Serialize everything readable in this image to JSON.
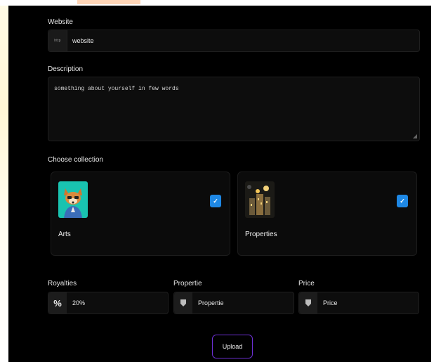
{
  "form": {
    "website": {
      "label": "Website",
      "prefix": "http",
      "value": "website"
    },
    "description": {
      "label": "Description",
      "placeholder": "something about yourself in few words"
    },
    "collection": {
      "label": "Choose collection",
      "cards": [
        {
          "title": "Arts",
          "checked": true
        },
        {
          "title": "Properties",
          "checked": true
        }
      ]
    },
    "royalties": {
      "label": "Royalties",
      "symbol": "%",
      "value": "20%"
    },
    "propertie": {
      "label": "Propertie",
      "value": "Propertie"
    },
    "price": {
      "label": "Price",
      "value": "Price"
    },
    "upload_label": "Upload"
  },
  "colors": {
    "panel_bg": "#000000",
    "check_blue": "#1e88e5",
    "upload_border": "#6a2fd0"
  },
  "icons": {
    "checkbox": "check-icon",
    "tag": "tag-icon"
  }
}
